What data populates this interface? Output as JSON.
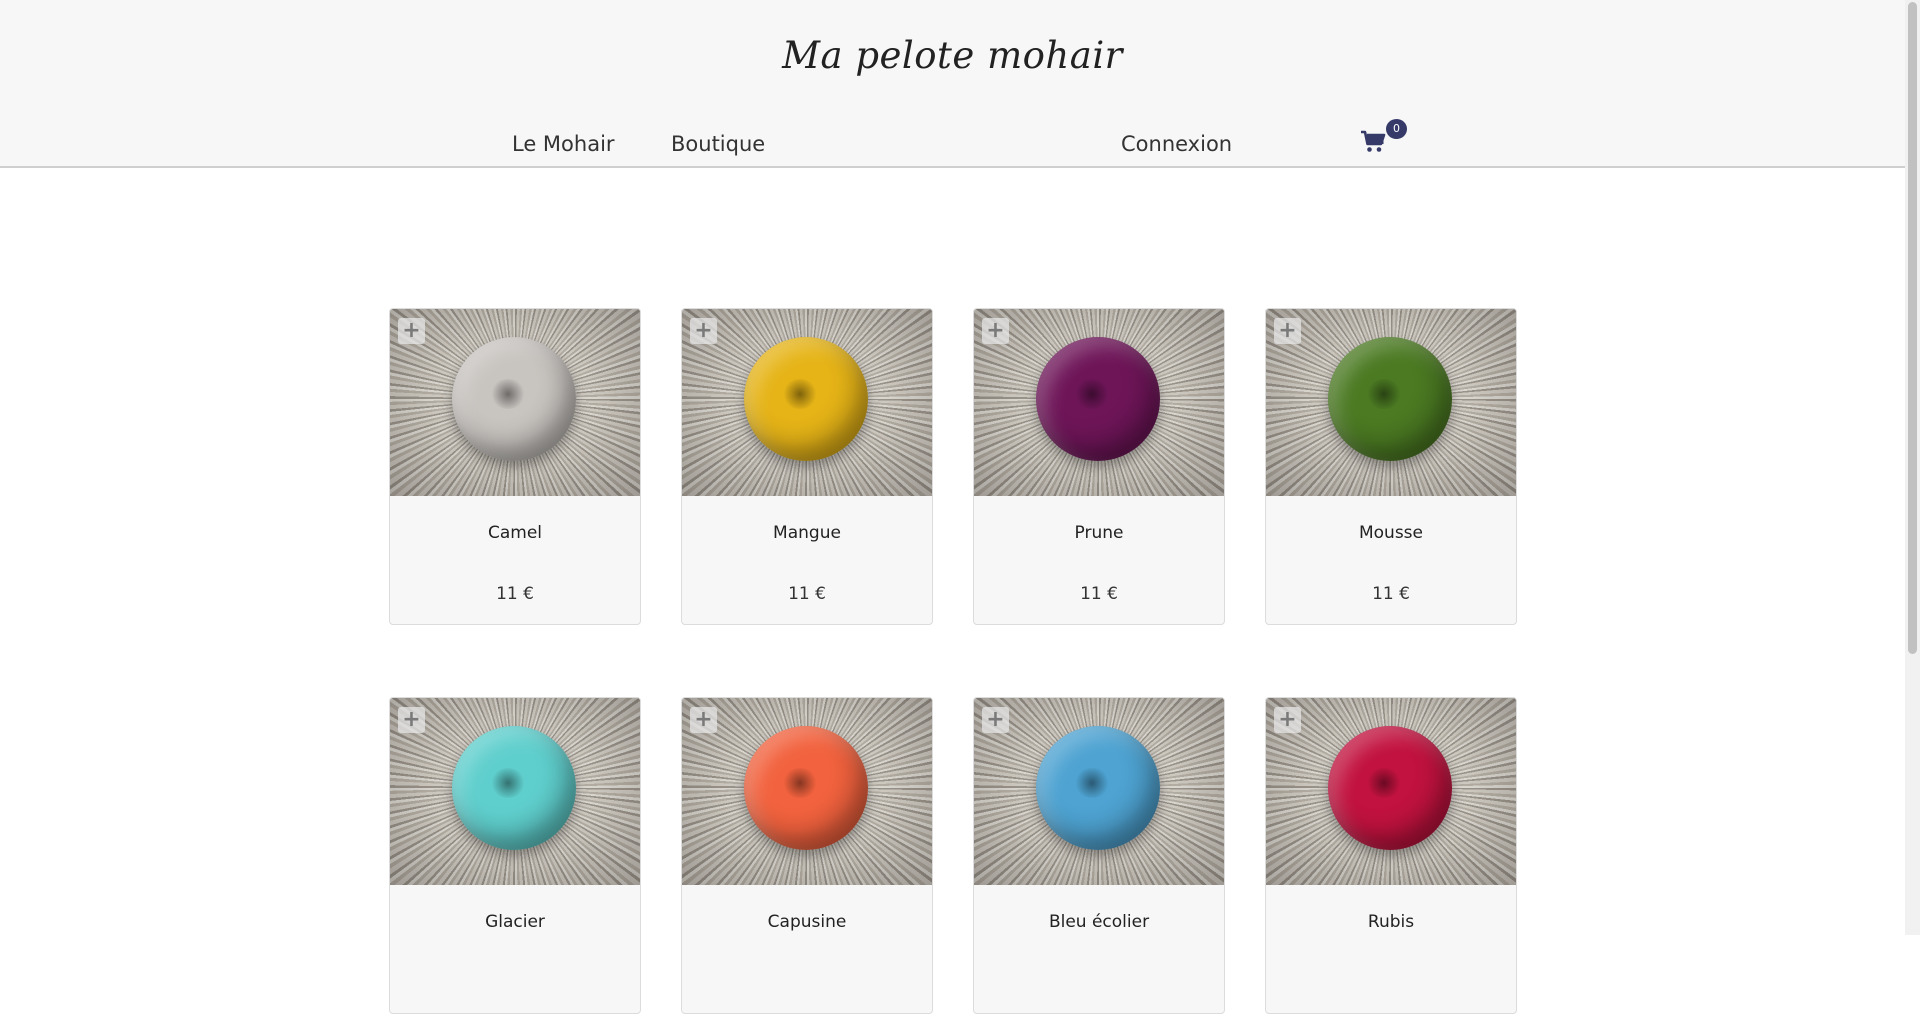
{
  "header": {
    "brand": "Ma pelote mohair",
    "nav": {
      "le_mohair": "Le Mohair",
      "boutique": "Boutique",
      "connexion": "Connexion"
    },
    "cart": {
      "icon": "cart-icon",
      "count": "0",
      "badge_color": "#363a69"
    }
  },
  "products": [
    {
      "name": "Camel",
      "price": "11 €",
      "color": "#c8c4c0",
      "add_icon": "plus-icon"
    },
    {
      "name": "Mangue",
      "price": "11 €",
      "color": "#e6b417",
      "add_icon": "plus-icon"
    },
    {
      "name": "Prune",
      "price": "11 €",
      "color": "#6e1558",
      "add_icon": "plus-icon"
    },
    {
      "name": "Mousse",
      "price": "11 €",
      "color": "#4b7a22",
      "add_icon": "plus-icon"
    },
    {
      "name": "Glacier",
      "price": "",
      "color": "#5fcfcd",
      "add_icon": "plus-icon"
    },
    {
      "name": "Capusine",
      "price": "",
      "color": "#f2623e",
      "add_icon": "plus-icon"
    },
    {
      "name": "Bleu écolier",
      "price": "",
      "color": "#4ea3d2",
      "add_icon": "plus-icon"
    },
    {
      "name": "Rubis",
      "price": "",
      "color": "#c2123f",
      "add_icon": "plus-icon"
    }
  ]
}
